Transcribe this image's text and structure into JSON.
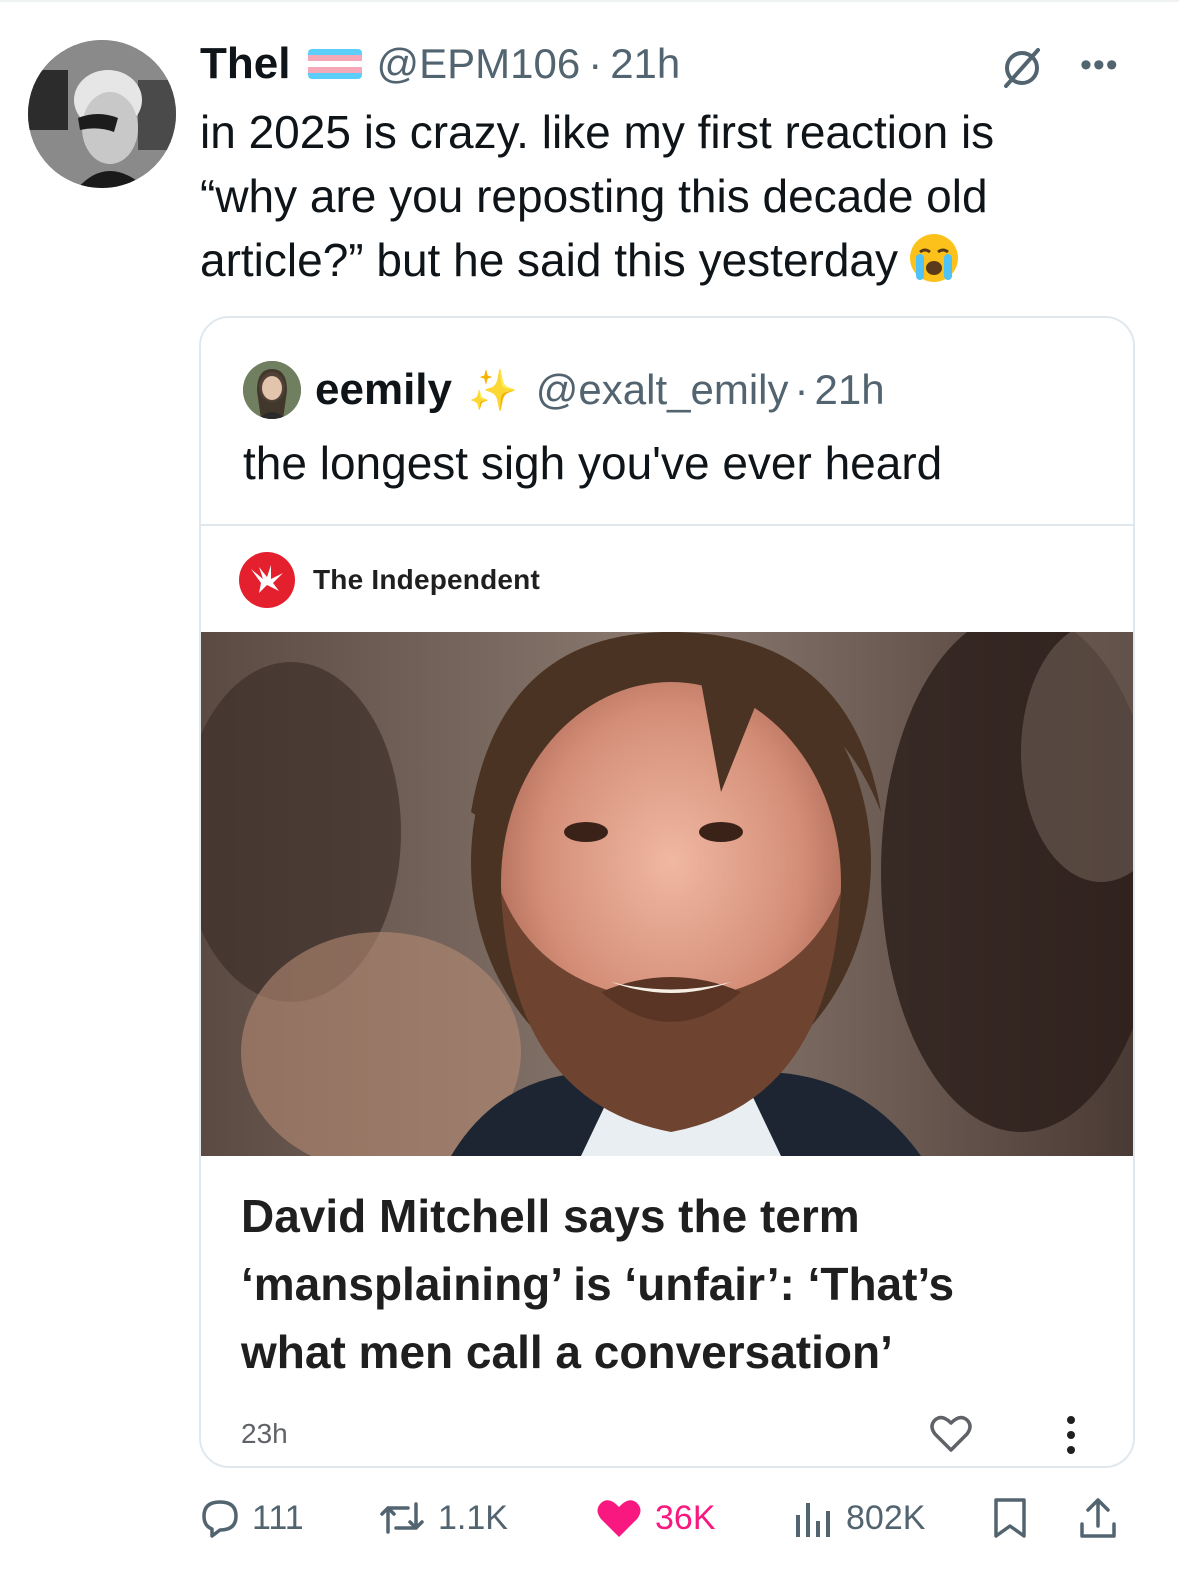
{
  "tweet": {
    "author_name": "Thel",
    "author_handle": "@EPM106",
    "separator": "·",
    "time": "21h",
    "text": "in 2025 is crazy. like my first reaction is “why are you reposting this decade old article?” but he said this yesterday",
    "emoji": "loudly-crying-face"
  },
  "quote": {
    "author_name": "eemily",
    "author_handle": "@exalt_emily",
    "separator": "·",
    "time": "21h",
    "text": "the longest sigh you've ever heard",
    "card": {
      "publisher": "The Independent",
      "title": "David Mitchell says the term ‘mansplaining’ is ‘unfair’: ‘That’s what men call a conversation’",
      "time": "23h"
    }
  },
  "actions": {
    "replies": "111",
    "reposts": "1.1K",
    "likes": "36K",
    "views": "802K"
  },
  "colors": {
    "text_primary": "#0f1419",
    "text_secondary": "#536471",
    "like": "#f91880",
    "independent_red": "#e4202e",
    "trans_blue": "#5bcefa",
    "trans_pink": "#f5a9b8"
  }
}
